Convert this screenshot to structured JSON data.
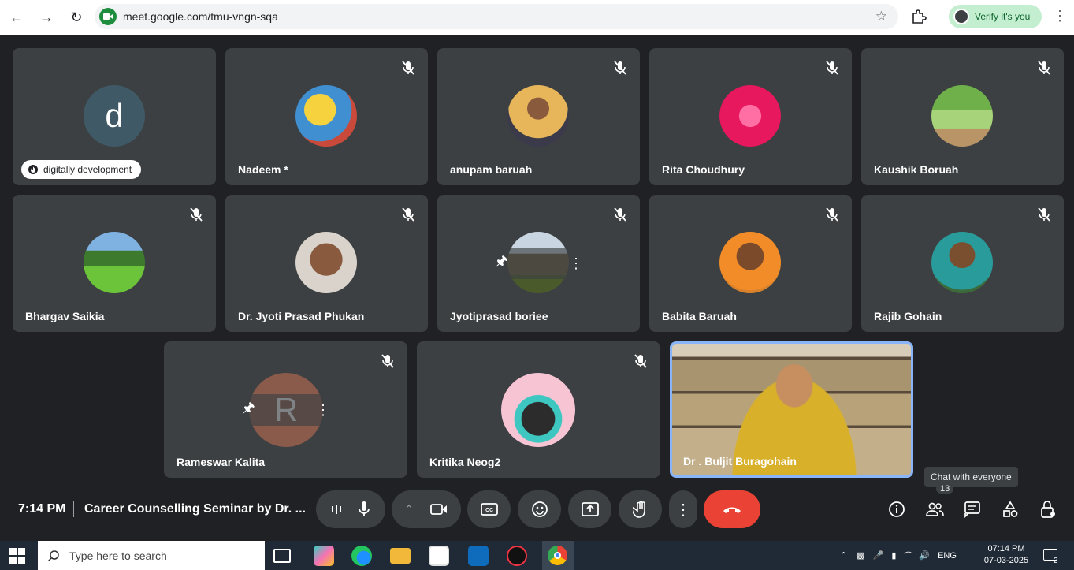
{
  "browser": {
    "url": "meet.google.com/tmu-vngn-sqa",
    "verify_label": "Verify it's you"
  },
  "tiles": {
    "t1": {
      "name": "digitally development",
      "letter": "d"
    },
    "t2": {
      "name": "Nadeem *"
    },
    "t3": {
      "name": "anupam baruah"
    },
    "t4": {
      "name": "Rita Choudhury"
    },
    "t5": {
      "name": "Kaushik Boruah"
    },
    "t6": {
      "name": "Bhargav Saikia"
    },
    "t7": {
      "name": "Dr. Jyoti Prasad Phukan"
    },
    "t8": {
      "name": "Jyotiprasad boriee"
    },
    "t9": {
      "name": "Babita Baruah"
    },
    "t10": {
      "name": "Rajib Gohain"
    },
    "t11": {
      "name": "Rameswar Kalita",
      "letter": "R"
    },
    "t12": {
      "name": "Kritika Neog2"
    },
    "t13": {
      "name": "Dr . Buljit Buragohain"
    }
  },
  "controls": {
    "time": "7:14 PM",
    "title": "Career Counselling Seminar by Dr. ...",
    "tooltip": "Chat with everyone",
    "people_count": "13"
  },
  "taskbar": {
    "search_placeholder": "Type here to search",
    "lang": "ENG",
    "time": "07:14 PM",
    "date": "07-03-2025",
    "notif_count": "2"
  },
  "colors": {
    "tile_bg": "#3c4043",
    "page_bg": "#202124",
    "end_call": "#ea4335",
    "active_speaker_border": "#8ab4f8"
  }
}
